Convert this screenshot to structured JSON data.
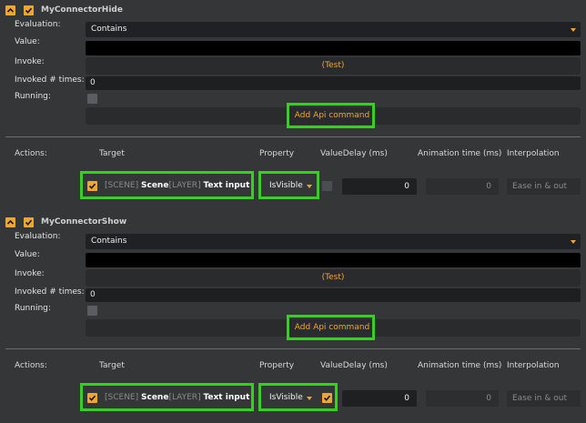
{
  "connectors": [
    {
      "title": "MyConnectorHide",
      "labels": {
        "evaluation": "Evaluation:",
        "value": "Value:",
        "invoke": "Invoke:",
        "invoked_times": "Invoked # times:",
        "running": "Running:"
      },
      "evaluation_value": "Contains",
      "value_value": "",
      "test_button": "(Test)",
      "invoked_times_value": "0",
      "add_api_button": "Add Api command",
      "actions": {
        "label": "Actions:",
        "col_target": "Target",
        "col_property": "Property",
        "col_value_delay": "ValueDelay (ms)",
        "col_animation": "Animation time (ms)",
        "col_interpolation": "Interpolation",
        "row": {
          "target_scene_tag": "[SCENE]",
          "target_scene": "Scene",
          "target_layer_tag": "[LAYER]",
          "target_layer": "Text input",
          "property": "IsVisible",
          "value_checked": false,
          "delay": "0",
          "animation_time": "0",
          "interpolation": "Ease in & out"
        }
      }
    },
    {
      "title": "MyConnectorShow",
      "labels": {
        "evaluation": "Evaluation:",
        "value": "Value:",
        "invoke": "Invoke:",
        "invoked_times": "Invoked # times:",
        "running": "Running:"
      },
      "evaluation_value": "Contains",
      "value_value": "",
      "test_button": "(Test)",
      "invoked_times_value": "0",
      "add_api_button": "Add Api command",
      "actions": {
        "label": "Actions:",
        "col_target": "Target",
        "col_property": "Property",
        "col_value_delay": "ValueDelay (ms)",
        "col_animation": "Animation time (ms)",
        "col_interpolation": "Interpolation",
        "row": {
          "target_scene_tag": "[SCENE]",
          "target_scene": "Scene",
          "target_layer_tag": "[LAYER]",
          "target_layer": "Text input",
          "property": "IsVisible",
          "value_checked": true,
          "delay": "0",
          "animation_time": "0",
          "interpolation": "Ease in & out"
        }
      }
    }
  ],
  "colors": {
    "accent": "#f0a634",
    "highlight": "#33d21d",
    "background": "#343638"
  },
  "icons": {
    "collapse": "chevron-up-icon",
    "check": "checkmark-icon",
    "dropdown": "caret-down-icon"
  }
}
